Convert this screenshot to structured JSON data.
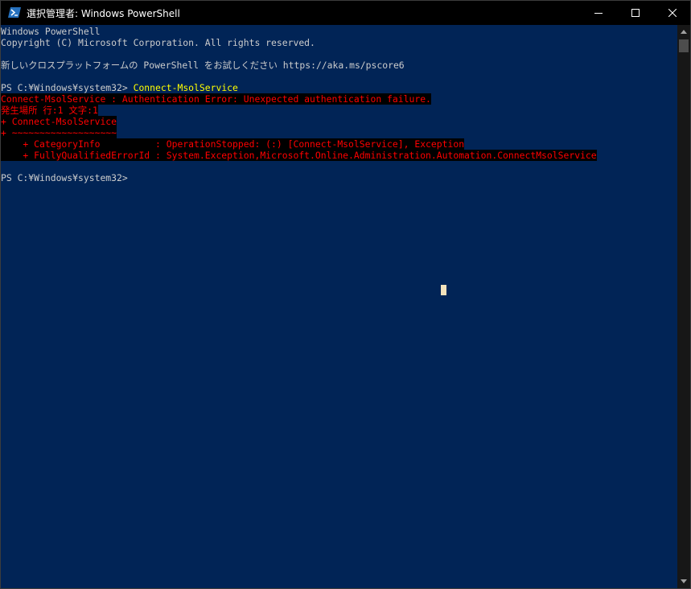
{
  "window": {
    "title": "選択管理者: Windows PowerShell",
    "icon": "powershell-icon"
  },
  "controls": {
    "minimize_icon": "minimize-icon",
    "maximize_icon": "maximize-icon",
    "close_icon": "close-icon"
  },
  "console": {
    "lines": [
      "Windows PowerShell",
      "Copyright (C) Microsoft Corporation. All rights reserved.",
      "",
      "新しいクロスプラットフォームの PowerShell をお試しください https://aka.ms/pscore6",
      "",
      "PS C:¥Windows¥system32> ",
      "Connect-MsolService : Authentication Error: Unexpected authentication failure.",
      "発生場所 行:1 文字:1",
      "+ Connect-MsolService",
      "+ ~~~~~~~~~~~~~~~~~~~",
      "    + CategoryInfo          : OperationStopped: (:) [Connect-MsolService], Exception",
      "    + FullyQualifiedErrorId : System.Exception,Microsoft.Online.Administration.Automation.ConnectMsolService",
      "",
      "",
      "PS C:¥Windows¥system32> "
    ],
    "prompt_command": "Connect-MsolService"
  },
  "colors": {
    "console_background": "#012456",
    "console_foreground": "#cccccc",
    "error_foreground": "#ff0000",
    "error_background": "#000000",
    "command_foreground": "#ffff00",
    "titlebar_background": "#000000"
  }
}
